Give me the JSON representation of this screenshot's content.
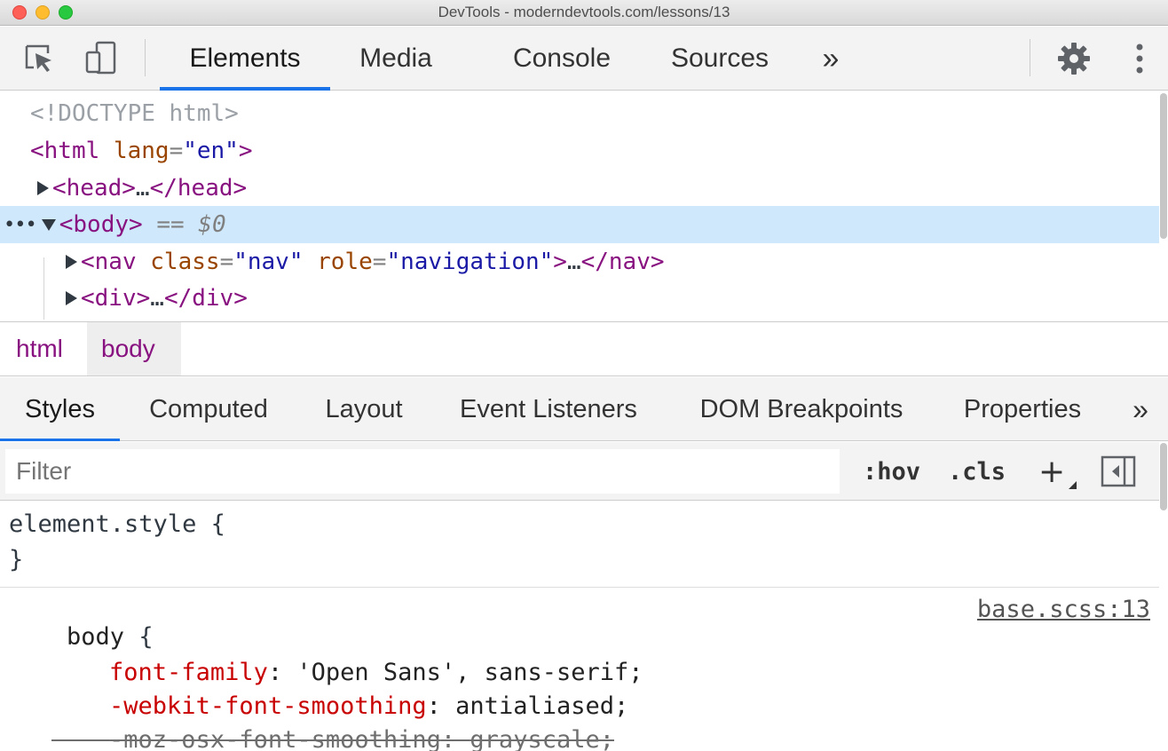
{
  "window": {
    "title": "DevTools - moderndevtools.com/lessons/13"
  },
  "toolbar": {
    "inspect_icon": "inspect-element-icon",
    "device_icon": "device-toolbar-icon",
    "tabs": [
      "Elements",
      "Media",
      "Console",
      "Sources"
    ],
    "more_tabs": "»",
    "settings_icon": "gear-icon",
    "menu_icon": "kebab-menu-icon",
    "accent": "#1a73e8"
  },
  "dom": {
    "doctype": "<!DOCTYPE html>",
    "html_open": "<html",
    "html_attr": "lang",
    "html_attr_val": "\"en\"",
    "head_open": "<head>",
    "head_ellipsis": "…",
    "head_close": "</head>",
    "body_tag": "<body>",
    "body_marker": "== $0",
    "nav_open": "<nav",
    "nav_attr1": "class",
    "nav_attr1_val": "\"nav\"",
    "nav_attr2": "role",
    "nav_attr2_val": "\"navigation\"",
    "nav_ellipsis": "…",
    "nav_close": "</nav>",
    "div_open": "<div>",
    "div_ellipsis": "…",
    "div_close": "</div>",
    "selected_color": "#cfe8fc"
  },
  "breadcrumb": {
    "items": [
      "html",
      "body"
    ]
  },
  "sidebar": {
    "tabs": [
      "Styles",
      "Computed",
      "Layout",
      "Event Listeners",
      "DOM Breakpoints",
      "Properties"
    ],
    "more": "»"
  },
  "filter": {
    "placeholder": "Filter",
    "hov": ":hov",
    "cls": ".cls",
    "add_rule": "+",
    "toggle_sidebar_icon": "toggle-sidebar-icon"
  },
  "styles": {
    "element_style_open": "element.style {",
    "element_style_close": "}",
    "rule_selector": "body",
    "rule_brace": "{",
    "rule_source": "base.scss:13",
    "declarations": [
      {
        "prop": "font-family",
        "value": "'Open Sans', sans-serif;"
      },
      {
        "prop": "-webkit-font-smoothing",
        "value": "antialiased;"
      },
      {
        "prop": "-moz-osx-font-smoothing",
        "value": "grayscale;"
      }
    ]
  }
}
